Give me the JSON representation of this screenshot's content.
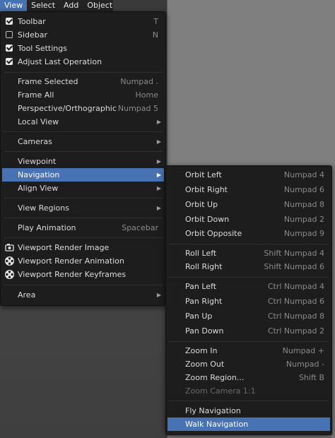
{
  "menubar": {
    "tabs": [
      "View",
      "Select",
      "Add",
      "Object"
    ]
  },
  "view_menu": {
    "checks": [
      {
        "label": "Toolbar",
        "shortcut": "T",
        "checked": true
      },
      {
        "label": "Sidebar",
        "shortcut": "N",
        "checked": false
      },
      {
        "label": "Tool Settings",
        "shortcut": "",
        "checked": true
      },
      {
        "label": "Adjust Last Operation",
        "shortcut": "",
        "checked": true
      }
    ],
    "frame": [
      {
        "label": "Frame Selected",
        "shortcut": "Numpad ."
      },
      {
        "label": "Frame All",
        "shortcut": "Home"
      },
      {
        "label": "Perspective/Orthographic",
        "shortcut": "Numpad 5"
      },
      {
        "label": "Local View",
        "shortcut": ""
      }
    ],
    "cameras": "Cameras",
    "view": [
      {
        "label": "Viewpoint"
      },
      {
        "label": "Navigation"
      },
      {
        "label": "Align View"
      }
    ],
    "view_regions": "View Regions",
    "play_animation": {
      "label": "Play Animation",
      "shortcut": "Spacebar"
    },
    "render": [
      "Viewport Render Image",
      "Viewport Render Animation",
      "Viewport Render Keyframes"
    ],
    "area": "Area"
  },
  "navigation_menu": {
    "orbit": [
      {
        "label": "Orbit Left",
        "shortcut": "Numpad 4"
      },
      {
        "label": "Orbit Right",
        "shortcut": "Numpad 6"
      },
      {
        "label": "Orbit Up",
        "shortcut": "Numpad 8"
      },
      {
        "label": "Orbit Down",
        "shortcut": "Numpad 2"
      },
      {
        "label": "Orbit Opposite",
        "shortcut": "Numpad 9"
      }
    ],
    "roll": [
      {
        "label": "Roll Left",
        "shortcut": "Shift Numpad 4"
      },
      {
        "label": "Roll Right",
        "shortcut": "Shift Numpad 6"
      }
    ],
    "pan": [
      {
        "label": "Pan Left",
        "shortcut": "Ctrl Numpad 4"
      },
      {
        "label": "Pan Right",
        "shortcut": "Ctrl Numpad 6"
      },
      {
        "label": "Pan Up",
        "shortcut": "Ctrl Numpad 8"
      },
      {
        "label": "Pan Down",
        "shortcut": "Ctrl Numpad 2"
      }
    ],
    "zoom": [
      {
        "label": "Zoom In",
        "shortcut": "Numpad +"
      },
      {
        "label": "Zoom Out",
        "shortcut": "Numpad -"
      },
      {
        "label": "Zoom Region...",
        "shortcut": "Shift B"
      },
      {
        "label": "Zoom Camera 1:1",
        "shortcut": ""
      }
    ],
    "fly_walk": [
      {
        "label": "Fly Navigation"
      },
      {
        "label": "Walk Navigation"
      }
    ]
  },
  "colors": {
    "highlight": "#4772b3",
    "menu_bg": "#1d1d1d",
    "shortcut": "#8a8a8a"
  }
}
